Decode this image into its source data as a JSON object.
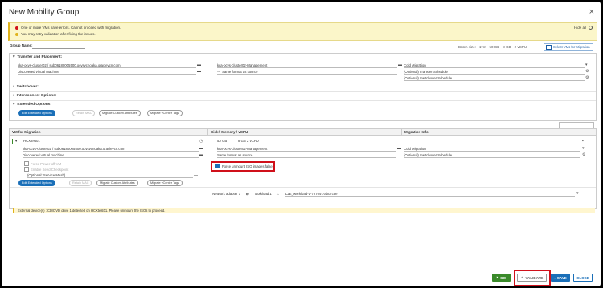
{
  "dialog": {
    "title": "New Mobility Group",
    "close_glyph": "×"
  },
  "alert": {
    "line1": "One or more VMs have errors. Cannot proceed with migration.",
    "line2": "You may retry validation after fixing the issues.",
    "hide_all": "Hide all"
  },
  "group_name": {
    "label": "Group Name:",
    "value": ""
  },
  "batch": {
    "label": "Batch size:",
    "count": "1vm",
    "storage": "50 GB",
    "memory": "8 GB",
    "cpu": "2 vCPU"
  },
  "select_vms_button": "Select VMs for Migration",
  "transfer": {
    "title": "Transfer and Placement:",
    "target_folder": "kka-ocvs-cluster02 / sub06180005500.ocvsvcnoaka.oraclevcn.com",
    "network": "kka-ocvs-cluster02-Management",
    "migration_type": "Cold Migration",
    "vm_type": "Discovered virtual machine",
    "storage_format": "Same format as source",
    "transfer_schedule": "(Optional) Transfer Schedule",
    "switchover_schedule": "(Optional) Switchover Schedule"
  },
  "sections": {
    "switchover": "Switchover:",
    "interconnect": "Interconnect Options:",
    "extended": "Extended Options:"
  },
  "extended_pills": {
    "edit": "Edit Extended Options",
    "retain_mac": "Retain MAC",
    "migrate_attrs": "Migrate Custom Attributes",
    "migrate_tags": "Migrate vCenter Tags"
  },
  "table": {
    "col_vm": "VM for Migration",
    "col_disk": "Disk / Memory / vCPU",
    "col_info": "Migration Info",
    "vm_name": "HCXtest01",
    "disk": "50 GB",
    "memory_cpu": "8 GB  2 vCPU",
    "target_folder": "kka-ocvs-cluster02 / sub06180005500.ocvsvcnoaka.oraclevcn.com",
    "network": "kka-ocvs-cluster02-Management",
    "migration_type": "Cold Migration",
    "vm_type": "Discovered virtual machine",
    "storage_format": "Same format as source",
    "switchover_schedule": "(Optional) Switchover Schedule",
    "force_power_off": "Force Power-off VM",
    "enable_seed": "Enable Seed Checkpoint",
    "service_mesh": "(Optional: Service Mesh)",
    "force_unmount": "Force unmount ISO images false",
    "network_adapter": "Network adapter 1",
    "source_network": "workload 1",
    "target_network": "L2E_workload-1-72704-7abc7c8e"
  },
  "row_pills": {
    "edit": "Edit Extended Options",
    "retain_mac": "Retain MAC",
    "migrate_attrs": "Migrate Custom Attributes",
    "migrate_tags": "Migrate vCenter Tags"
  },
  "warning": "External device(s) : CD/DVD drive 1 detected on HCXtest01. Please unmount the ISOs to proceed.",
  "buttons": {
    "go": "GO",
    "validate": "VALIDATE",
    "save": "SAVE",
    "close": "CLOSE"
  },
  "colors": {
    "go": "#3a8a2a",
    "save": "#1a6fb8",
    "highlight": "#d0101a",
    "alert_bg": "#fbf6c9"
  }
}
